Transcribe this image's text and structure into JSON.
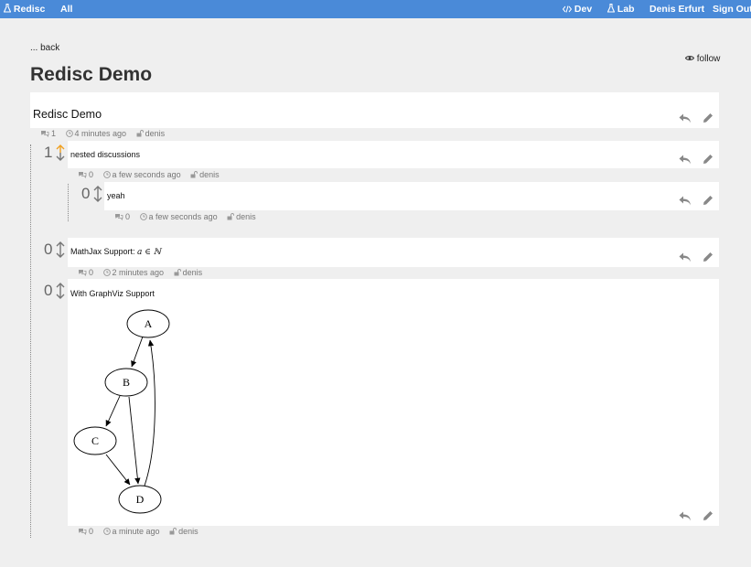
{
  "navbar": {
    "brand": "Redisc",
    "all": "All",
    "dev": "Dev",
    "lab": "Lab",
    "user": "Denis Erfurt",
    "signout": "Sign Out"
  },
  "back_label": "... back",
  "follow_label": "follow",
  "page_title": "Redisc Demo",
  "root": {
    "title": "Redisc Demo",
    "comments": "1",
    "time": "4 minutes ago",
    "author": "denis"
  },
  "posts": [
    {
      "score": "1",
      "upvoted": true,
      "text": "nested discussions",
      "comments": "0",
      "time": "a few seconds ago",
      "author": "denis"
    },
    {
      "score": "0",
      "upvoted": false,
      "text": "yeah",
      "comments": "0",
      "time": "a few seconds ago",
      "author": "denis"
    },
    {
      "score": "0",
      "upvoted": false,
      "text": "MathJax Support: ",
      "math": "a ∈ ℕ",
      "comments": "0",
      "time": "2 minutes ago",
      "author": "denis"
    },
    {
      "score": "0",
      "upvoted": false,
      "text": "With GraphViz Support",
      "comments": "0",
      "time": "a minute ago",
      "author": "denis"
    }
  ],
  "graph": {
    "nodes": [
      "A",
      "B",
      "C",
      "D"
    ]
  },
  "colors": {
    "navbar": "#4a8ad8",
    "background": "#efefef",
    "upvote": "#f0a020"
  }
}
